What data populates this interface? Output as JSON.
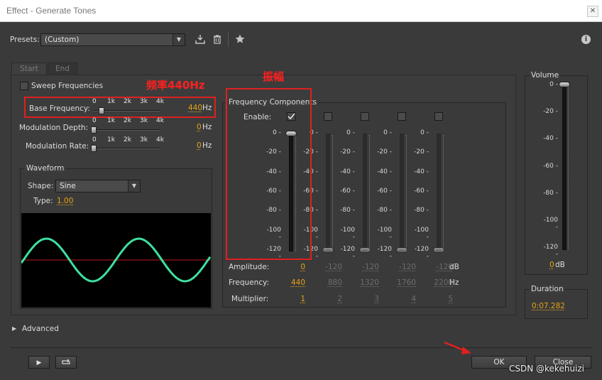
{
  "window": {
    "title": "Effect - Generate Tones",
    "close_glyph": "✕"
  },
  "presets": {
    "label": "Presets:",
    "value": "(Custom)"
  },
  "tabs": [
    "Start",
    "End"
  ],
  "sweep": {
    "label": "Sweep Frequencies",
    "checked": false
  },
  "params": [
    {
      "label": "Base Frequency:",
      "value": "440",
      "unit": "Hz"
    },
    {
      "label": "Modulation Depth:",
      "value": "0",
      "unit": "Hz"
    },
    {
      "label": "Modulation Rate:",
      "value": "0",
      "unit": "Hz"
    }
  ],
  "slider_ticks": [
    "0",
    "1k",
    "2k",
    "3k",
    "4k"
  ],
  "waveform": {
    "title": "Waveform",
    "shape_label": "Shape:",
    "shape_value": "Sine",
    "type_label": "Type:",
    "type_value": "1.00"
  },
  "annotations": {
    "base_freq": "频率440Hz",
    "amplitude": "振幅"
  },
  "components": {
    "title": "Frequency Components",
    "enable_label": "Enable:",
    "db_ticks": [
      "0",
      "-20",
      "-40",
      "-60",
      "-80",
      "-100",
      "-120"
    ],
    "amplitude_label": "Amplitude:",
    "frequency_label": "Frequency:",
    "multiplier_label": "Multiplier:",
    "amp_unit": "dB",
    "freq_unit": "Hz",
    "channels": [
      {
        "enabled": true,
        "amplitude": "0",
        "frequency": "440",
        "multiplier": "1"
      },
      {
        "enabled": false,
        "amplitude": "-120",
        "frequency": "880",
        "multiplier": "2"
      },
      {
        "enabled": false,
        "amplitude": "-120",
        "frequency": "1320",
        "multiplier": "3"
      },
      {
        "enabled": false,
        "amplitude": "-120",
        "frequency": "1760",
        "multiplier": "4"
      },
      {
        "enabled": false,
        "amplitude": "-120",
        "frequency": "2200",
        "multiplier": "5"
      }
    ]
  },
  "volume": {
    "title": "Volume",
    "ticks": [
      "0",
      "-20",
      "-40",
      "-60",
      "-80",
      "-100",
      "-120"
    ],
    "value": "0",
    "unit": "dB"
  },
  "duration": {
    "title": "Duration",
    "value": "0:07.282"
  },
  "advanced": {
    "label": "Advanced"
  },
  "buttons": {
    "ok": "OK",
    "close": "Close"
  },
  "watermark": "CSDN @kekehuizi"
}
